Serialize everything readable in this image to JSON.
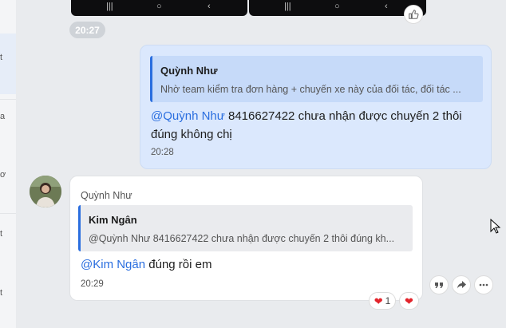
{
  "sidebar": {
    "snippets": [
      "t",
      "a",
      "ơ",
      "t",
      "t"
    ]
  },
  "image_strip": {
    "nav_left": [
      "|||",
      "○",
      "‹"
    ],
    "nav_right": [
      "|||",
      "○",
      "‹"
    ],
    "like_icon": "thumbs-up-icon"
  },
  "time_separator": "20:27",
  "outgoing": {
    "quote_name": "Quỳnh Như",
    "quote_text": "Nhờ team kiểm tra đơn hàng + chuyến xe này của đối tác, đối tác ...",
    "mention": "@Quỳnh Như",
    "text": " 8416627422  chưa nhận được chuyến 2 thôi đúng không chị",
    "time": "20:28"
  },
  "incoming": {
    "sender": "Quỳnh Như",
    "quote_name": "Kim Ngân",
    "quote_text": "@Quỳnh Như 8416627422 chưa nhận được chuyến 2 thôi đúng kh...",
    "mention": "@Kim Ngân",
    "text": " đúng rồi em",
    "time": "20:29"
  },
  "actions": [
    "quote-icon",
    "share-icon",
    "more-icon"
  ],
  "reactions": {
    "heart_count": "1"
  },
  "colors": {
    "mention": "#2a6edf",
    "outgoing_bubble": "#dbe8fd",
    "heart": "#e3242b"
  }
}
